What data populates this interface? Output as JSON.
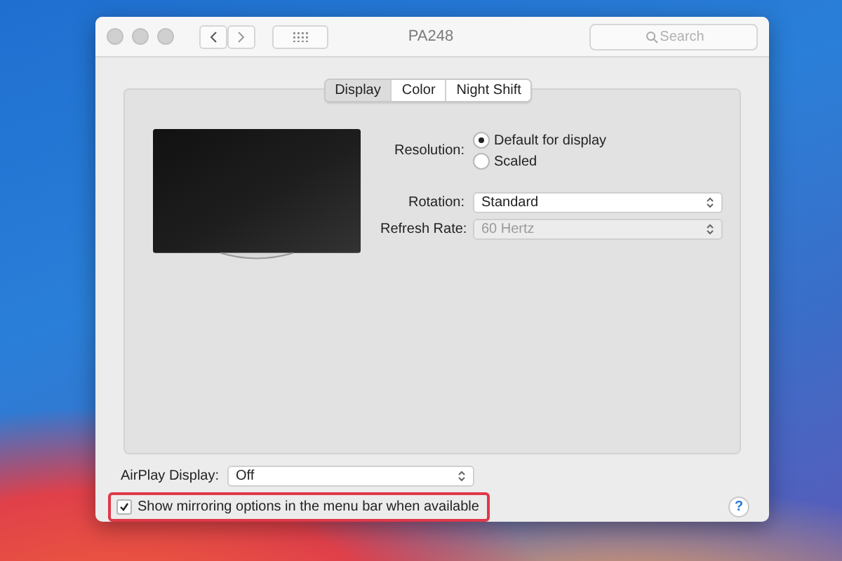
{
  "window": {
    "title": "PA248"
  },
  "toolbar": {
    "search": {
      "placeholder": "Search"
    }
  },
  "tabs": [
    {
      "label": "Display",
      "selected": true
    },
    {
      "label": "Color",
      "selected": false
    },
    {
      "label": "Night Shift",
      "selected": false
    }
  ],
  "resolution": {
    "label": "Resolution:",
    "options": [
      {
        "label": "Default for display",
        "selected": true
      },
      {
        "label": "Scaled",
        "selected": false
      }
    ]
  },
  "rotation": {
    "label": "Rotation:",
    "value": "Standard",
    "disabled": false
  },
  "refresh_rate": {
    "label": "Refresh Rate:",
    "value": "60 Hertz",
    "disabled": true
  },
  "airplay": {
    "label": "AirPlay Display:",
    "value": "Off"
  },
  "mirroring": {
    "label": "Show mirroring options in the menu bar when available",
    "checked": true,
    "highlighted": true
  },
  "help": {
    "label": "?"
  }
}
